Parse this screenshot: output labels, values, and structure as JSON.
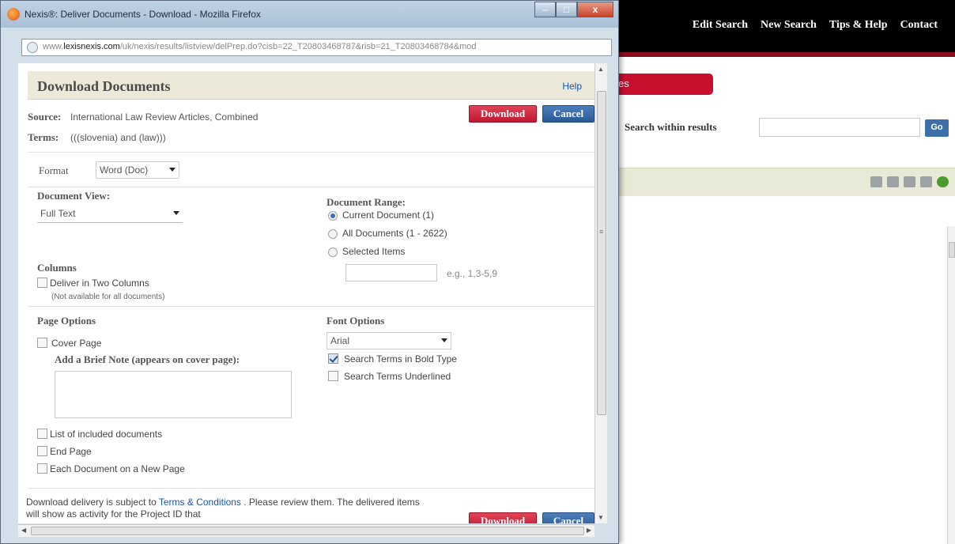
{
  "background": {
    "nav": [
      "Edit Search",
      "New Search",
      "Tips & Help",
      "Contact"
    ],
    "tab_label": "es",
    "search_within_label": "Search within results",
    "go_label": "Go"
  },
  "window": {
    "title": "Nexis®: Deliver Documents - Download - Mozilla Firefox",
    "min_label": "–",
    "max_label": "□",
    "close_label": "x",
    "url_prefix": "www.",
    "url_domain": "lexisnexis.com",
    "url_path": "/uk/nexis/results/listview/delPrep.do?cisb=22_T20803468787&risb=21_T20803468784&mod"
  },
  "dialog": {
    "title": "Download Documents",
    "help": "Help",
    "source_label": "Source:",
    "source_value": "International Law Review Articles, Combined",
    "terms_label": "Terms:",
    "terms_value": "(((slovenia) and (law)))",
    "download_label": "Download",
    "cancel_label": "Cancel",
    "format_label": "Format",
    "format_value": "Word (Doc)",
    "document_view_label": "Document View:",
    "document_view_value": "Full Text",
    "document_range_label": "Document Range:",
    "range_options": [
      "Current Document (1)",
      "All Documents (1 - 2622)",
      "Selected Items"
    ],
    "range_example": "e.g., 1,3-5,9",
    "columns_label": "Columns",
    "two_columns_label": "Deliver in Two Columns",
    "two_columns_note": "(Not available for all documents)",
    "page_options_label": "Page Options",
    "cover_page_label": "Cover Page",
    "brief_note_label": "Add a Brief Note (appears on cover page):",
    "font_options_label": "Font Options",
    "font_value": "Arial",
    "bold_terms_label": "Search Terms in Bold Type",
    "underline_terms_label": "Search Terms Underlined",
    "list_docs_label": "List of included documents",
    "end_page_label": "End Page",
    "new_page_label": "Each Document on a New Page",
    "bottom_text_1": "Download delivery is subject to ",
    "terms_link": "Terms & Conditions",
    "bottom_text_2": " . Please review them. The delivered items will show as activity for the Project ID that"
  }
}
